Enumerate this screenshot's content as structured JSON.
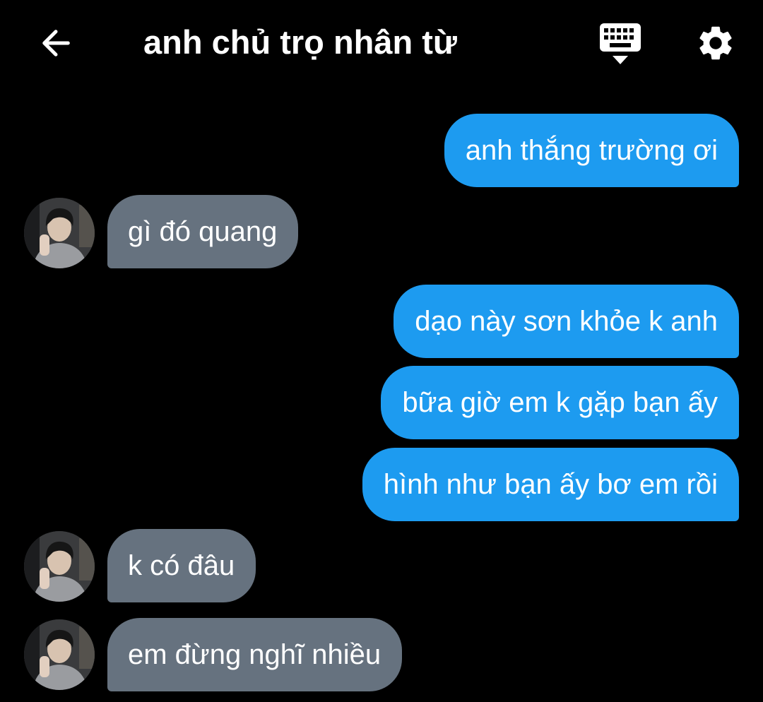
{
  "header": {
    "title": "anh chủ trọ nhân từ",
    "back_icon": "arrow-left-icon",
    "keyboard_icon": "keyboard-icon",
    "settings_icon": "gear-icon"
  },
  "colors": {
    "background": "#000000",
    "sent_bubble": "#1d9bf0",
    "received_bubble": "#66727f",
    "text": "#ffffff"
  },
  "messages": [
    {
      "direction": "sent",
      "text": "anh thắng trường ơi"
    },
    {
      "direction": "received",
      "text": "gì đó quang"
    },
    {
      "direction": "sent",
      "text": "dạo này sơn khỏe k anh"
    },
    {
      "direction": "sent",
      "text": "bữa giờ em k gặp bạn ấy"
    },
    {
      "direction": "sent",
      "text": "hình như bạn ấy bơ em rồi"
    },
    {
      "direction": "received",
      "text": "k có đâu"
    },
    {
      "direction": "received",
      "text": "em đừng nghĩ nhiều"
    }
  ]
}
